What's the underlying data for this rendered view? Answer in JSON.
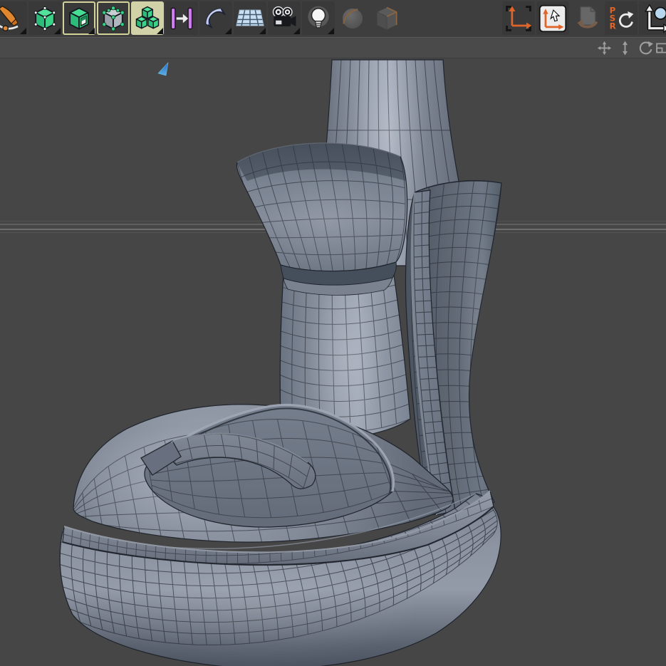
{
  "toolbar": {
    "left_tools": [
      {
        "id": "pen-spline-tool",
        "submenu": true
      },
      {
        "id": "model-mode",
        "submenu": true
      },
      {
        "id": "polygon-mode",
        "highlight": "border",
        "submenu": true
      },
      {
        "id": "point-mode",
        "highlight": "border"
      },
      {
        "id": "object-mode",
        "highlight": "fill",
        "submenu": true
      },
      {
        "id": "axis-mode"
      },
      {
        "id": "falloff-tool",
        "submenu": true
      },
      {
        "id": "workplane-mode",
        "submenu": true
      },
      {
        "id": "camera-mode",
        "submenu": true
      },
      {
        "id": "light-tool",
        "submenu": true
      },
      {
        "id": "sphere-tool",
        "disabled": true
      },
      {
        "id": "cube-tool",
        "disabled": true
      }
    ],
    "right_tools": [
      {
        "id": "coordinate-system"
      },
      {
        "id": "workplane-coordinates"
      },
      {
        "id": "paste-tool",
        "disabled": true
      },
      {
        "id": "reset-psr"
      },
      {
        "id": "snap-settings"
      }
    ],
    "psr_letters": [
      "P",
      "S",
      "R"
    ]
  },
  "viewport": {
    "nav_controls": [
      {
        "id": "pan"
      },
      {
        "id": "zoom"
      },
      {
        "id": "rotate"
      },
      {
        "id": "maximize"
      }
    ],
    "scene": {
      "object": "wireframe boot model",
      "shading": "shaded with wireframe lines"
    },
    "colors": {
      "background": "#464646",
      "mesh_surface": "#7d8593",
      "mesh_highlight": "#a4acba",
      "wireframe": "#22272f",
      "horizon_line": "#6c6c6c",
      "selection_triangle": "#3f8fd8",
      "active_tile": "#d2d2a8"
    }
  }
}
